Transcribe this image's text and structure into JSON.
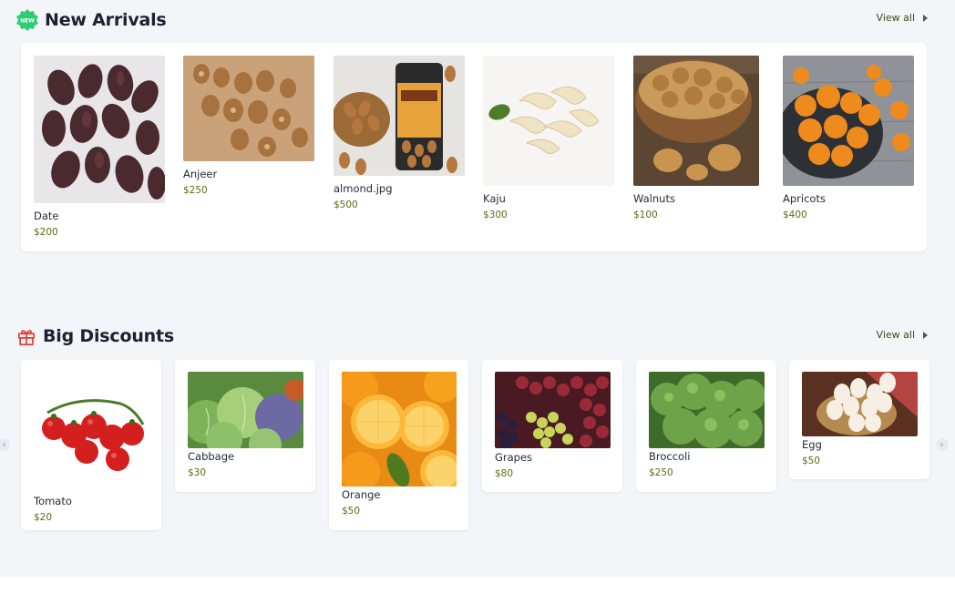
{
  "new_arrivals": {
    "badge": "NEW",
    "title": "New Arrivals",
    "view_all": "View all",
    "items": [
      {
        "name": "Date",
        "price": "$200",
        "image": "dates-photo"
      },
      {
        "name": "Anjeer",
        "price": "$250",
        "image": "dried-figs-photo"
      },
      {
        "name": "almond.jpg",
        "price": "$500",
        "image": "almonds-jar-photo"
      },
      {
        "name": "Kaju",
        "price": "$300",
        "image": "cashews-photo"
      },
      {
        "name": "Walnuts",
        "price": "$100",
        "image": "walnuts-bowl-photo"
      },
      {
        "name": "Apricots",
        "price": "$400",
        "image": "dried-apricots-photo"
      }
    ]
  },
  "big_discounts": {
    "title": "Big Discounts",
    "view_all": "View all",
    "items": [
      {
        "name": "Tomato",
        "price": "$20",
        "image": "cherry-tomatoes-photo"
      },
      {
        "name": "Cabbage",
        "price": "$30",
        "image": "cabbages-photo"
      },
      {
        "name": "Orange",
        "price": "$50",
        "image": "oranges-photo"
      },
      {
        "name": "Grapes",
        "price": "$80",
        "image": "grapes-photo"
      },
      {
        "name": "Broccoli",
        "price": "$250",
        "image": "broccoli-photo"
      },
      {
        "name": "Egg",
        "price": "$50",
        "image": "eggs-basket-photo"
      }
    ]
  },
  "colors": {
    "accent_green": "#2ecc71",
    "price_olive": "#5b6b10",
    "gift_red": "#e53935",
    "background": "#f3f5f9"
  }
}
